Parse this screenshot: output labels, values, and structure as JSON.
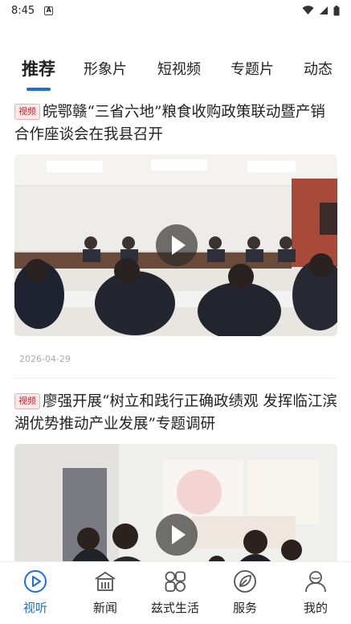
{
  "status_bar": {
    "time": "8:45",
    "notif_glyph": "A"
  },
  "tabs": [
    {
      "label": "推荐"
    },
    {
      "label": "形象片"
    },
    {
      "label": "短视频"
    },
    {
      "label": "专题片"
    },
    {
      "label": "动态"
    }
  ],
  "articles": [
    {
      "badge": "视频",
      "title": "皖鄂赣“三省六地”粮食收购政策联动暨产销合作座谈会在我县召开",
      "date": "2026-04-29"
    },
    {
      "badge": "视频",
      "title": "廖强开展“树立和践行正确政绩观 发挥临江滨湖优势推动产业发展”专题调研",
      "date": ""
    }
  ],
  "bottom_nav": [
    {
      "label": "视听",
      "icon": "play-circle-icon"
    },
    {
      "label": "新闻",
      "icon": "building-icon"
    },
    {
      "label": "兹式生活",
      "icon": "grid-icon"
    },
    {
      "label": "服务",
      "icon": "leaf-icon"
    },
    {
      "label": "我的",
      "icon": "user-icon"
    }
  ],
  "colors": {
    "accent": "#1e6fd9",
    "badge_red": "#c9252b"
  }
}
